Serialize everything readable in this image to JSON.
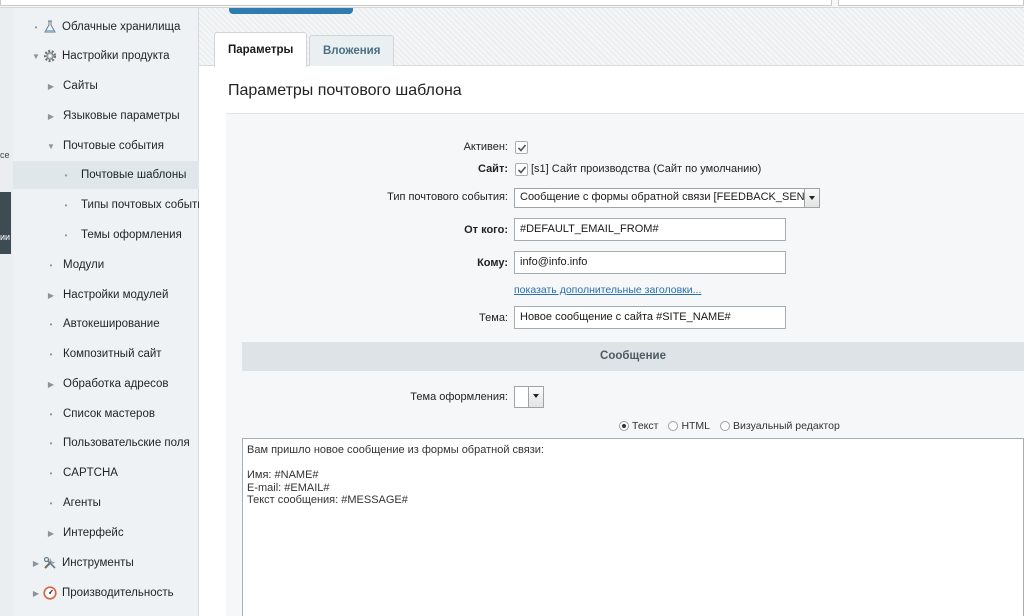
{
  "leftstrip": {
    "text_top": "ce",
    "text_dark": "ии"
  },
  "sidebar": {
    "items": [
      {
        "label": "Облачные хранилища",
        "marker": "•",
        "icon": "flask-icon"
      },
      {
        "label": "Настройки продукта",
        "marker": "▼",
        "icon": "gear-icon"
      },
      {
        "label": "Сайты",
        "marker": "▶"
      },
      {
        "label": "Языковые параметры",
        "marker": "▶"
      },
      {
        "label": "Почтовые события",
        "marker": "▼"
      },
      {
        "label": "Почтовые шаблоны",
        "marker": "•",
        "active": true
      },
      {
        "label": "Типы почтовых событий",
        "marker": "•"
      },
      {
        "label": "Темы оформления",
        "marker": "•"
      },
      {
        "label": "Модули",
        "marker": "•"
      },
      {
        "label": "Настройки модулей",
        "marker": "▶"
      },
      {
        "label": "Автокеширование",
        "marker": "•"
      },
      {
        "label": "Композитный сайт",
        "marker": "•"
      },
      {
        "label": "Обработка адресов",
        "marker": "▶"
      },
      {
        "label": "Список мастеров",
        "marker": "•"
      },
      {
        "label": "Пользовательские поля",
        "marker": "•"
      },
      {
        "label": "CAPTCHA",
        "marker": "•"
      },
      {
        "label": "Агенты",
        "marker": "•"
      },
      {
        "label": "Интерфейс",
        "marker": "▶"
      },
      {
        "label": "Инструменты",
        "marker": "▶",
        "icon": "tools-icon"
      },
      {
        "label": "Производительность",
        "marker": "▶",
        "icon": "gauge-icon"
      }
    ]
  },
  "tabs": [
    {
      "label": "Параметры",
      "active": true
    },
    {
      "label": "Вложения",
      "active": false
    }
  ],
  "page_title": "Параметры почтового шаблона",
  "form": {
    "active_label": "Активен:",
    "active_checked": true,
    "site_label": "Сайт:",
    "site_checked": true,
    "site_value": "[s1] Сайт производства (Сайт по умолчанию)",
    "event_type_label": "Тип почтового события:",
    "event_type_value": "Сообщение с формы обратной связи [FEEDBACK_SEND",
    "from_label": "От кого:",
    "from_value": "#DEFAULT_EMAIL_FROM#",
    "to_label": "Кому:",
    "to_value": "info@info.info",
    "extra_headers_link": "показать дополнительные заголовки...",
    "subject_label": "Тема:",
    "subject_value": "Новое сообщение с сайта #SITE_NAME#",
    "section_title": "Сообщение",
    "theme_label": "Тема оформления:",
    "theme_value": "",
    "format_options": [
      {
        "label": "Текст",
        "selected": true
      },
      {
        "label": "HTML",
        "selected": false
      },
      {
        "label": "Визуальный редактор",
        "selected": false
      }
    ],
    "message_body": "Вам пришло новое сообщение из формы обратной связи:\n\nИмя: #NAME#\nE-mail: #EMAIL#\nТекст сообщения: #MESSAGE#"
  },
  "colors": {
    "accent": "#2f7db0",
    "link": "#2a6fb0",
    "section_bg": "#dde3e6"
  }
}
